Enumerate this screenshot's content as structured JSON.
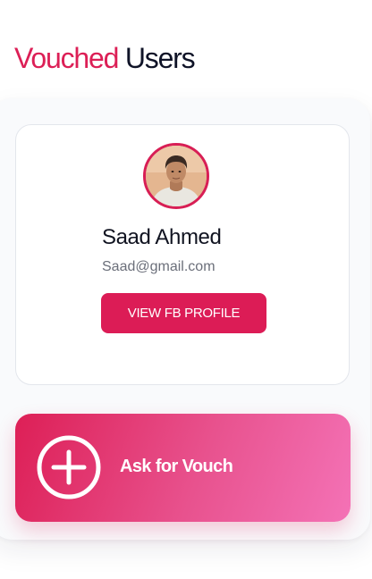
{
  "header": {
    "title_accent": "Vouched",
    "title_rest": " Users"
  },
  "user_card": {
    "name": "Saad Ahmed",
    "email": "Saad@gmail.com",
    "fb_button_label": "VIEW FB PROFILE"
  },
  "vouch_button": {
    "label": "Ask for Vouch",
    "icon": "plus-circle-icon"
  },
  "colors": {
    "accent": "#dc1f56",
    "title_dark": "#0f1327",
    "gradient_start": "#dd1f56",
    "gradient_end": "#f472b6"
  }
}
